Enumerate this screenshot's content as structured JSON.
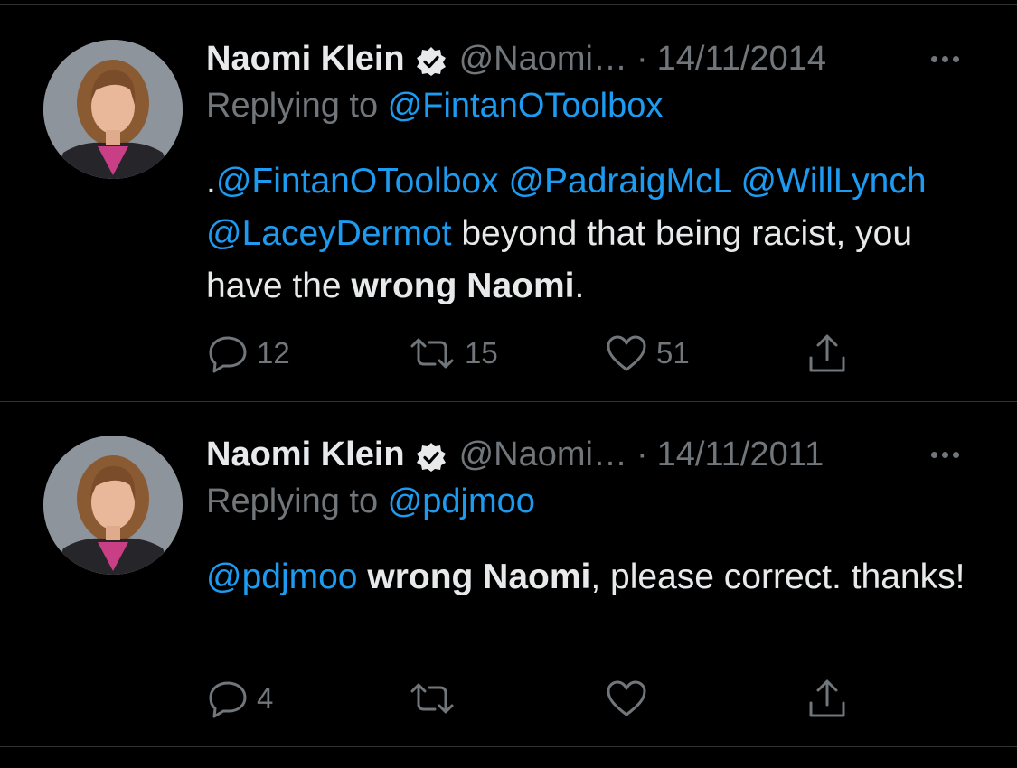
{
  "tweets": [
    {
      "author_name": "Naomi Klein",
      "handle": "@Naomi…",
      "separator": "·",
      "date": "14/11/2014",
      "replying_prefix": "Replying to ",
      "replying_to": "@FintanOToolbox",
      "body": {
        "lead": ".",
        "m1": "@FintanOToolbox",
        "m2": "@PadraigMcL",
        "m3": "@WillLynch",
        "m4": "@LaceyDermot",
        "t1": " beyond that being racist, you have the ",
        "bold": "wrong Naomi",
        "t2": "."
      },
      "replies": "12",
      "retweets": "15",
      "likes": "51"
    },
    {
      "author_name": "Naomi Klein",
      "handle": "@Naomi…",
      "separator": "·",
      "date": "14/11/2011",
      "replying_prefix": "Replying to ",
      "replying_to": "@pdjmoo",
      "body": {
        "m1": "@pdjmoo",
        "t0": " ",
        "bold": "wrong Naomi",
        "t1": ", please correct. thanks!"
      },
      "replies": "4",
      "retweets": "",
      "likes": ""
    }
  ],
  "icons": {
    "verified": "verified-badge-icon",
    "more": "more-dots-icon",
    "reply": "reply-bubble-icon",
    "retweet": "retweet-arrows-icon",
    "like": "heart-icon",
    "share": "share-upload-icon"
  },
  "colors": {
    "background": "#000000",
    "text": "#e7e9ea",
    "secondary": "#71767b",
    "link": "#1d9bf0",
    "divider": "#2f3336"
  }
}
